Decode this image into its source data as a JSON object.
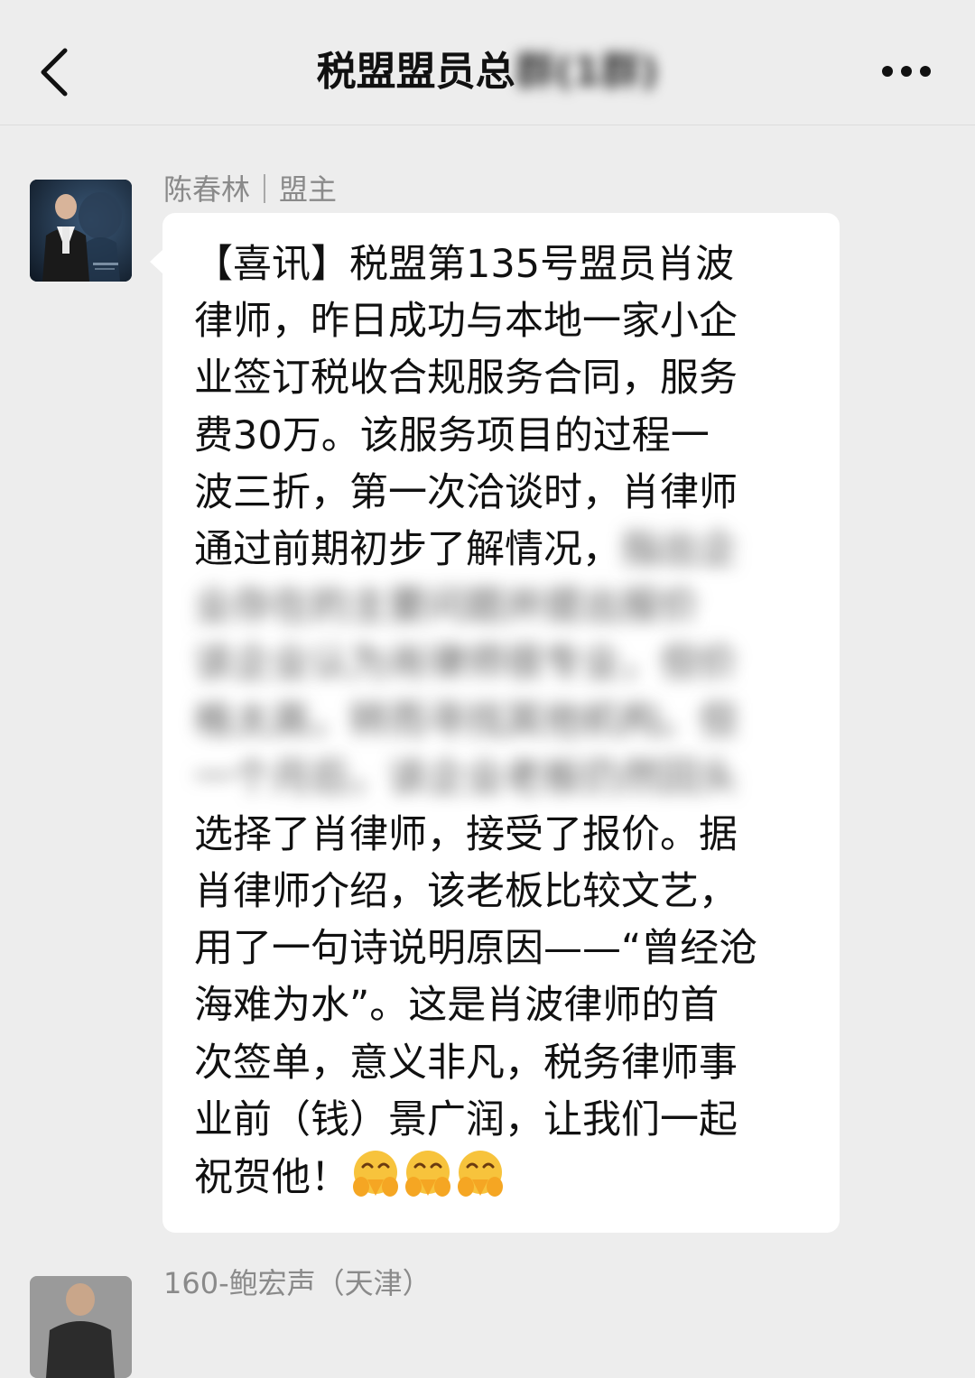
{
  "nav": {
    "title_visible": "税盟盟员总",
    "title_blurred": "群(1群)"
  },
  "messages": [
    {
      "sender": "陈春林｜盟主",
      "text_lines": [
        "【喜讯】税盟第135号盟员肖波",
        "律师，昨日成功与本地一家小企",
        "业签订税收合规服务合同，服务",
        "费30万。该服务项目的过程一",
        "波三折，第一次洽谈时，肖律师",
        "通过前期初步了解情况，"
      ],
      "blurred_lines": [
        "指出企",
        "业存在的主要问题并提出报价",
        "该企业认为肖律师很专业，但价",
        "格太高，转而寻找其他机构。但",
        "一个月后，该企业老板仍然回头"
      ],
      "text_lines_after": [
        "选择了肖律师，接受了报价。据",
        "肖律师介绍，该老板比较文艺，",
        "用了一句诗说明原因——“曾经沧",
        "海难为水”。这是肖波律师的首",
        "次签单，意义非凡，税务律师事",
        "业前（钱）景广润，让我们一起",
        "祝贺他！"
      ],
      "emojis": [
        "hands-over-mouth-emoji",
        "hands-over-mouth-emoji",
        "hands-over-mouth-emoji"
      ]
    },
    {
      "sender": "160-鲍宏声（天津）"
    }
  ]
}
